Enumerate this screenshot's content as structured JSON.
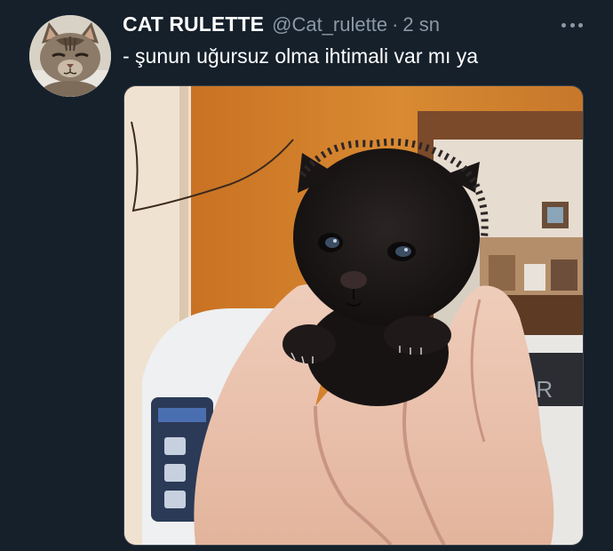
{
  "tweet": {
    "display_name": "CAT RULETTE",
    "handle": "@Cat_rulette",
    "separator": "·",
    "time": "2 sn",
    "text": "- şunun uğursuz olma ihtimali var mı ya"
  },
  "icons": {
    "more": "more-horizontal-icon"
  },
  "colors": {
    "background": "#15202b",
    "name": "#ffffff",
    "secondary_text": "#8b98a5",
    "body_text": "#ffffff"
  }
}
